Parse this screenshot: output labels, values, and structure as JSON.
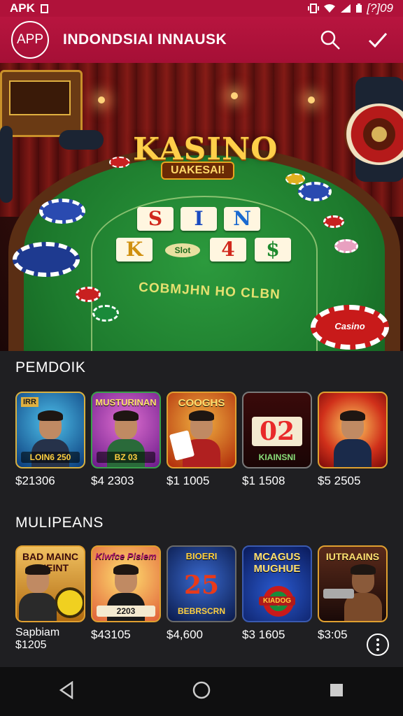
{
  "status_bar": {
    "carrier": "APK",
    "time": "[?]09"
  },
  "app_bar": {
    "logo_text": "APP",
    "title": "INDONDSIAI INNAUSK"
  },
  "hero": {
    "title": "KASINO",
    "subtitle": "UAKESAI!",
    "tiles": [
      "S",
      "I",
      "N",
      "K",
      "4",
      "$"
    ],
    "center_label": "Slot",
    "felt_text": "COBMJHN HO CLBN",
    "chip_text": "Casino"
  },
  "sections": [
    {
      "title": "PEMDOIK",
      "cards": [
        {
          "label": "",
          "sub": "LOIN6 250",
          "price": "$21306"
        },
        {
          "label": "MUSTURINAN",
          "sub": "BZ 03",
          "price": "$4 2303"
        },
        {
          "label": "COOGHS",
          "sub": "",
          "price": "$1 1005"
        },
        {
          "label": "",
          "big": "02",
          "sub": "KIAINSNI",
          "price": "$1 1508"
        },
        {
          "label": "",
          "sub": "",
          "price": "$5 2505"
        }
      ]
    },
    {
      "title": "MULIPEANS",
      "cards": [
        {
          "label": "BAD MAINC KNEINT",
          "sub": "",
          "price": "Sapbiam",
          "price2": "$1205"
        },
        {
          "label": "Kiwfce Pisiem",
          "sub": "2203",
          "price": "$43105"
        },
        {
          "label": "BIOERI",
          "big": "25",
          "sub": "BEBRSCRN",
          "price": "$4,600"
        },
        {
          "label": "MCAGUS MUGHUE",
          "sub": "KIADOG",
          "price": "$3 1605"
        },
        {
          "label": "IUTRAAINS",
          "sub": "",
          "price": "$3:05"
        }
      ]
    }
  ],
  "nav": {
    "back": "back-icon",
    "home": "home-icon",
    "recents": "recents-icon"
  },
  "colors": {
    "app_bar": "#b0123a",
    "background": "#1f1f22",
    "felt": "#1d7a2d",
    "gold": "#ffcf4a"
  }
}
